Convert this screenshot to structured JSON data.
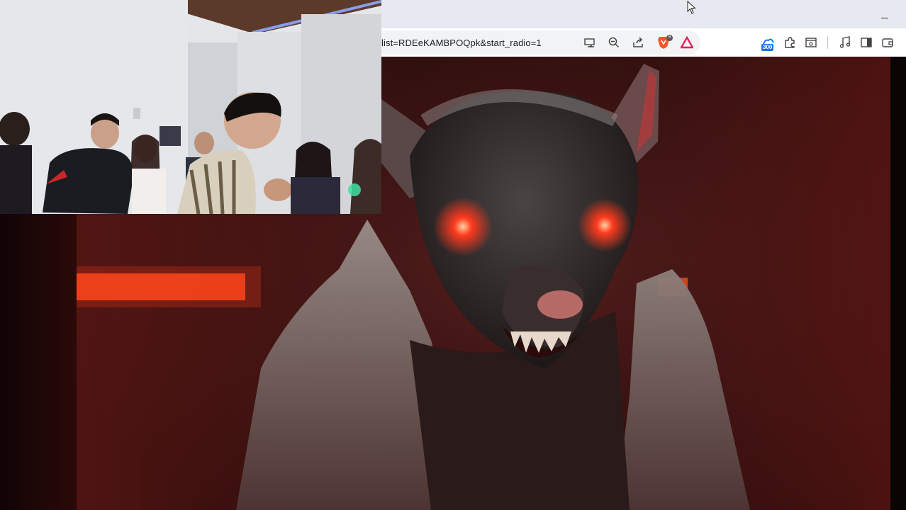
{
  "browser": {
    "url": "list=RDEeKAMBPOQpk&start_radio=1",
    "icons": {
      "cast": "cast-icon",
      "zoom": "zoom-out-icon",
      "share": "share-icon",
      "brave": "brave-shields-icon",
      "rewards": "brave-rewards-icon",
      "extension": "extension-300-icon",
      "puzzle": "extensions-puzzle-icon",
      "reader": "reader-mode-icon",
      "media": "media-controls-icon",
      "sidebar": "sidebar-icon",
      "wallet": "wallet-icon"
    },
    "extension_badge": "300",
    "brave_shield_count": "6",
    "window_minimize": "–"
  },
  "colors": {
    "titlebar": "#e6e9ef",
    "toolbar": "#ffffff",
    "brave_orange": "#fb542b",
    "rewards_red": "#e0245e",
    "video_red": "#5a2220",
    "eye_glow": "#ff3a1e"
  }
}
